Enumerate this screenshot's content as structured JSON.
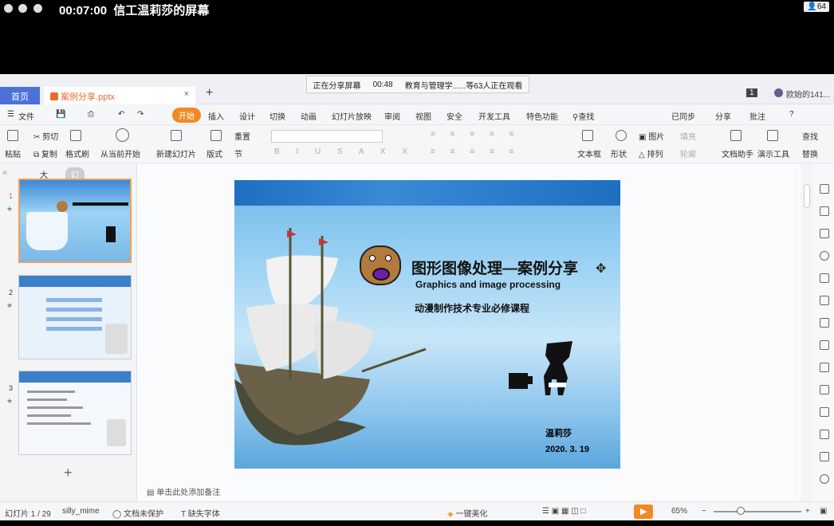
{
  "meeting": {
    "timer": "00:07:00",
    "title": "信工温莉莎的屏幕",
    "participants": "64"
  },
  "tabs": {
    "home": "首页",
    "file": "案例分享.pptx",
    "close": "×",
    "new": "+"
  },
  "share_banner": {
    "status": "正在分享屏幕",
    "time": "00:48",
    "viewers": "教育与管理学......等63人正在观看"
  },
  "window": {
    "page_badge": "1",
    "user": "欧始的141..."
  },
  "menu": {
    "file": "文件",
    "items": [
      "开始",
      "插入",
      "设计",
      "切换",
      "动画",
      "幻灯片放映",
      "审阅",
      "视图",
      "安全",
      "开发工具",
      "特色功能",
      "查找"
    ],
    "sync": "已同步",
    "share": "分享",
    "comment": "批注"
  },
  "ribbon": {
    "paste": "粘贴",
    "cut": "剪切",
    "copy": "复制",
    "format_painter": "格式刷",
    "from_current": "从当前开始",
    "new_slide": "新建幻灯片",
    "layout": "版式",
    "reset": "重置",
    "section": "节",
    "textbox": "文本框",
    "shape": "形状",
    "picture": "图片",
    "arrange": "排列",
    "doc_assistant": "文档助手",
    "presentation_tools": "演示工具",
    "find": "查找",
    "replace": "替换",
    "fill": "填充",
    "outline": "轮廓"
  },
  "left_panel": {
    "outline_tab": "大纲",
    "slides_tab": "幻灯片",
    "thumb_numbers": [
      "1",
      "2",
      "3"
    ],
    "add": "+"
  },
  "slide": {
    "title": "图形图像处理—案例分享",
    "subtitle": "Graphics and image processing",
    "course": "动漫制作技术专业必修课程",
    "author": "温莉莎",
    "date": "2020. 3. 19"
  },
  "notes": "单击此处添加备注",
  "status": {
    "slide_count": "幻灯片 1 / 29",
    "theme": "silly_mime",
    "protect": "文档未保护",
    "missing_font": "缺失字体",
    "beautify": "一键美化",
    "zoom": "65%"
  }
}
